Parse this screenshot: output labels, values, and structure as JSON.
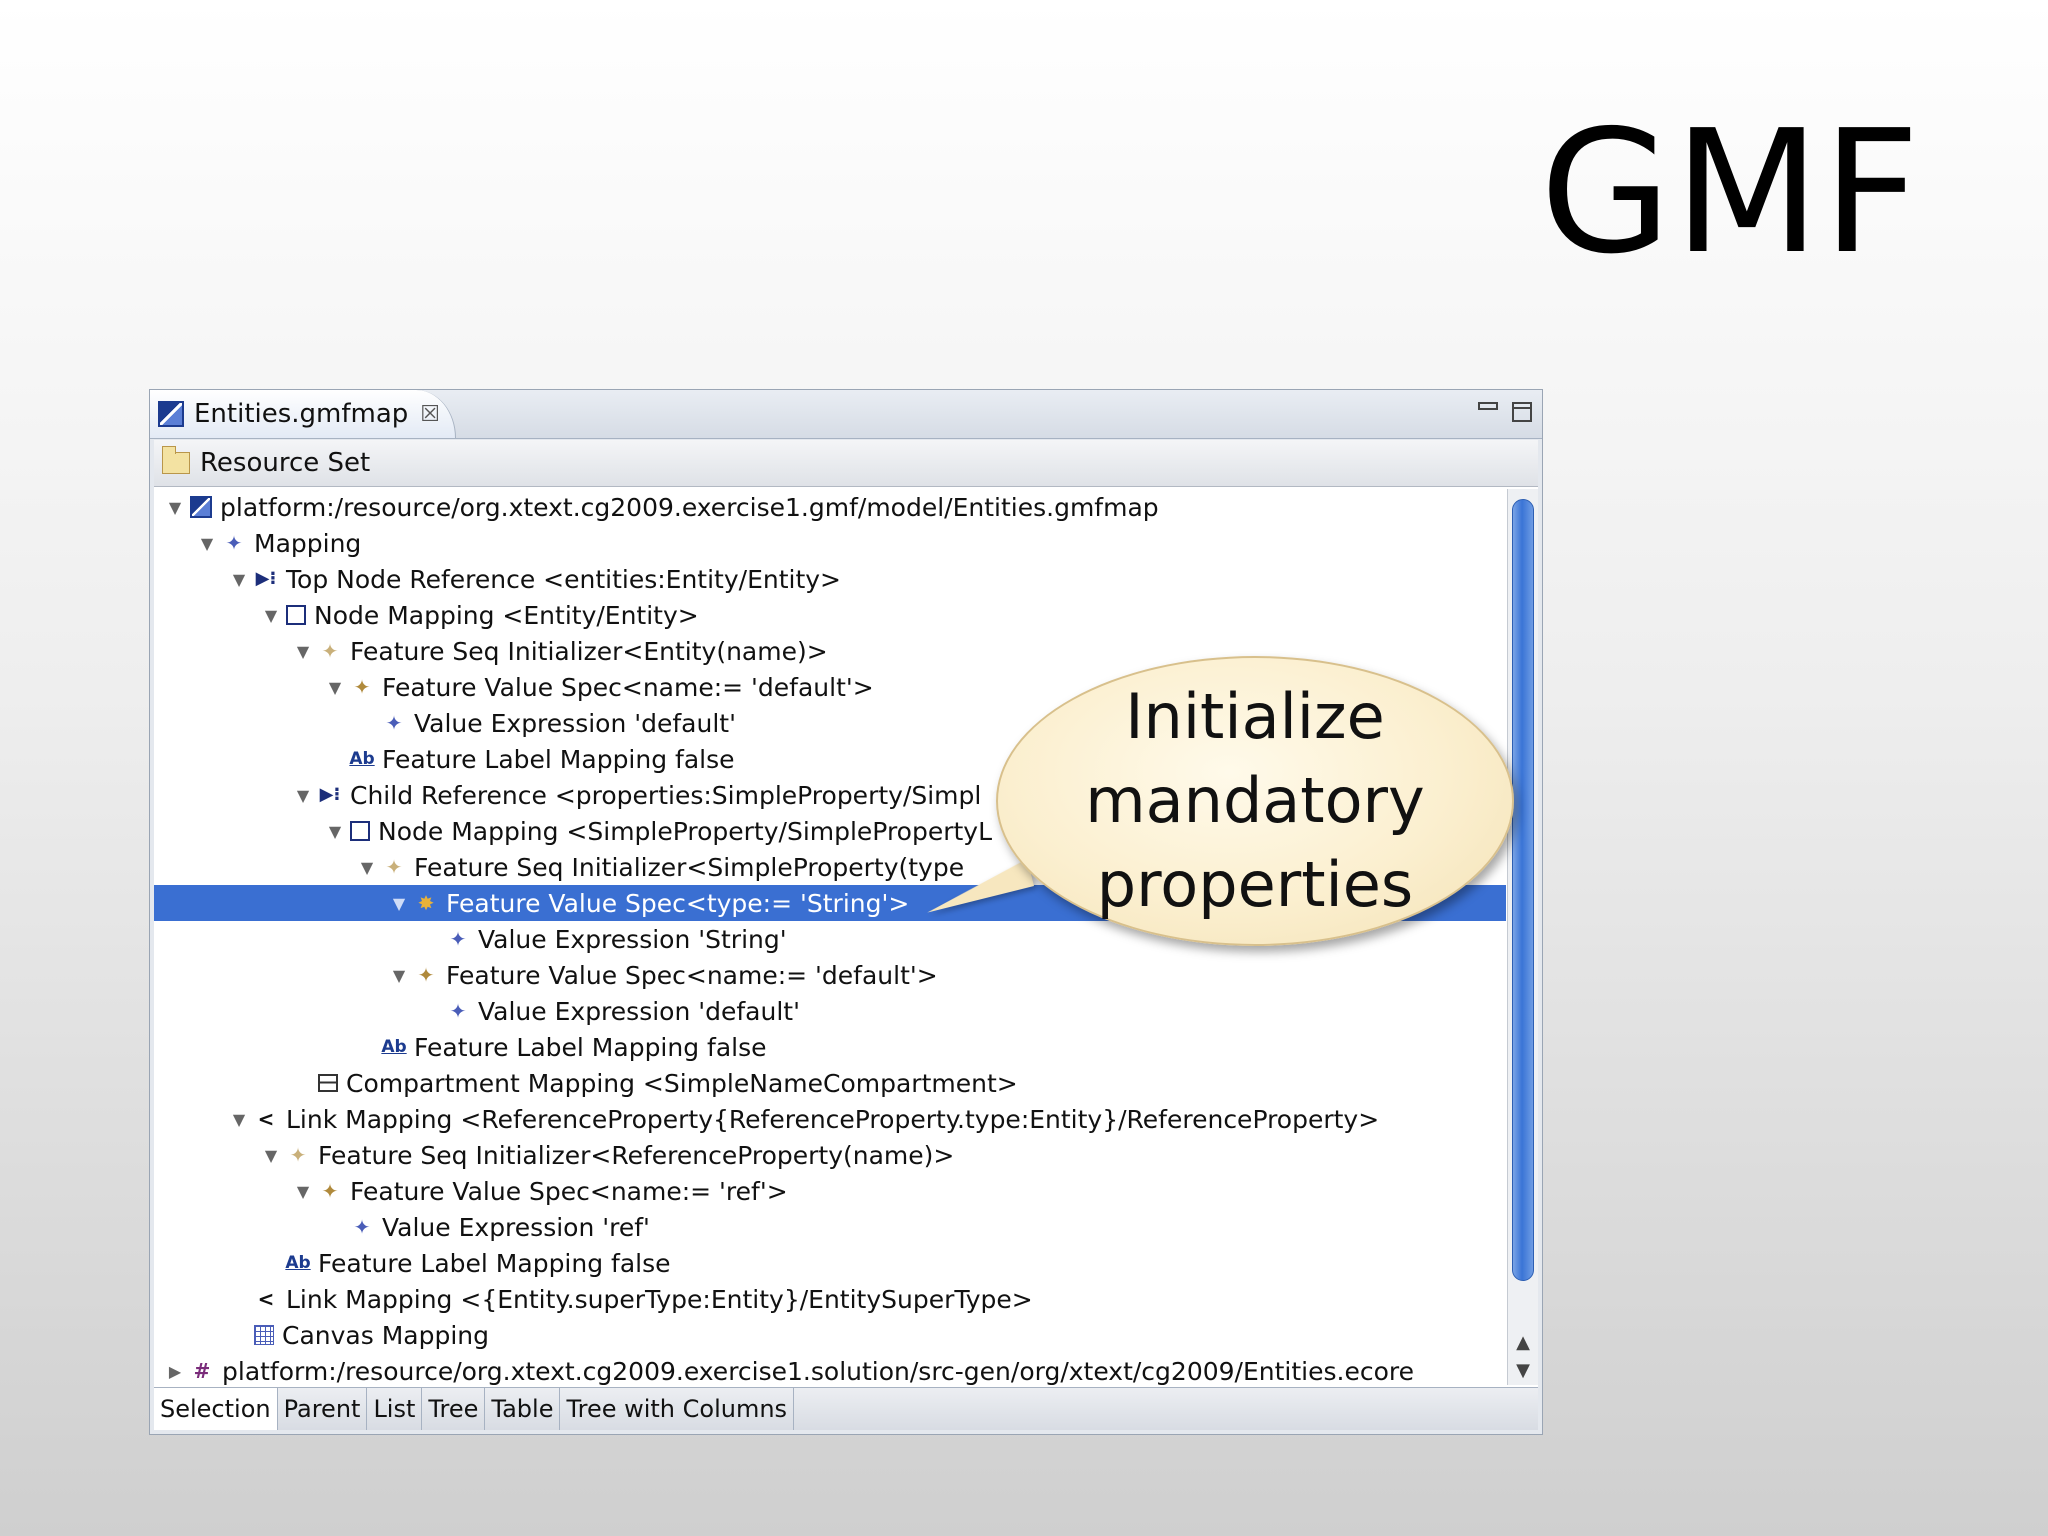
{
  "slide": {
    "title": "GMF"
  },
  "editor": {
    "tab_label": "Entities.gmfmap",
    "tab_close_glyph": "☒",
    "resource_set_label": "Resource Set"
  },
  "tree": {
    "rows": [
      {
        "text": "platform:/resource/org.xtext.cg2009.exercise1.gmf/model/Entities.gmfmap",
        "expanded": "open",
        "icon": "gmfmap-icon"
      },
      {
        "text": "Mapping",
        "expanded": "open",
        "icon": "mapping-diamond-icon"
      },
      {
        "text": "Top Node Reference <entities:Entity/Entity>",
        "expanded": "open",
        "icon": "top-node-reference-icon"
      },
      {
        "text": "Node Mapping <Entity/Entity>",
        "expanded": "open",
        "icon": "node-mapping-icon"
      },
      {
        "text": "Feature Seq Initializer<Entity(name)>",
        "expanded": "open",
        "icon": "feature-seq-initializer-icon"
      },
      {
        "text": "Feature Value Spec<name:= 'default'>",
        "expanded": "open",
        "icon": "feature-value-spec-icon"
      },
      {
        "text": "Value Expression 'default'",
        "expanded": "none",
        "icon": "value-expression-icon"
      },
      {
        "text": "Feature Label Mapping false",
        "expanded": "none",
        "icon": "label-mapping-icon"
      },
      {
        "text": "Child Reference <properties:SimpleProperty/Simpl",
        "expanded": "open",
        "icon": "child-reference-icon"
      },
      {
        "text": "Node Mapping <SimpleProperty/SimplePropertyL",
        "expanded": "open",
        "icon": "node-mapping-icon"
      },
      {
        "text": "Feature Seq Initializer<SimpleProperty(type",
        "expanded": "open",
        "icon": "feature-seq-initializer-icon"
      },
      {
        "text": "Feature Value Spec<type:= 'String'>",
        "expanded": "open",
        "icon": "feature-value-spec-gear-icon",
        "selected": true
      },
      {
        "text": "Value Expression 'String'",
        "expanded": "none",
        "icon": "value-expression-icon"
      },
      {
        "text": "Feature Value Spec<name:= 'default'>",
        "expanded": "open",
        "icon": "feature-value-spec-icon"
      },
      {
        "text": "Value Expression 'default'",
        "expanded": "none",
        "icon": "value-expression-icon"
      },
      {
        "text": "Feature Label Mapping false",
        "expanded": "none",
        "icon": "label-mapping-icon"
      },
      {
        "text": "Compartment Mapping <SimpleNameCompartment>",
        "expanded": "none",
        "icon": "compartment-mapping-icon"
      },
      {
        "text": "Link Mapping <ReferenceProperty{ReferenceProperty.type:Entity}/ReferenceProperty>",
        "expanded": "open",
        "icon": "link-mapping-icon"
      },
      {
        "text": "Feature Seq Initializer<ReferenceProperty(name)>",
        "expanded": "open",
        "icon": "feature-seq-initializer-icon"
      },
      {
        "text": "Feature Value Spec<name:= 'ref'>",
        "expanded": "open",
        "icon": "feature-value-spec-icon"
      },
      {
        "text": "Value Expression 'ref'",
        "expanded": "none",
        "icon": "value-expression-icon"
      },
      {
        "text": "Feature Label Mapping false",
        "expanded": "none",
        "icon": "label-mapping-icon"
      },
      {
        "text": "Link Mapping <{Entity.superType:Entity}/EntitySuperType>",
        "expanded": "none",
        "icon": "link-mapping-icon"
      },
      {
        "text": "Canvas Mapping",
        "expanded": "none",
        "icon": "canvas-mapping-icon"
      },
      {
        "text": "platform:/resource/org.xtext.cg2009.exercise1.solution/src-gen/org/xtext/cg2009/Entities.ecore",
        "expanded": "closed",
        "icon": "ecore-icon"
      }
    ]
  },
  "bottom_tabs": [
    "Selection",
    "Parent",
    "List",
    "Tree",
    "Table",
    "Tree with Columns"
  ],
  "callout": {
    "lines": [
      "Initialize",
      "mandatory",
      "properties"
    ]
  },
  "colors": {
    "selection": "#3a6fd2",
    "callout_fill": "#fbefcf",
    "scroll_thumb": "#3a74d6"
  }
}
